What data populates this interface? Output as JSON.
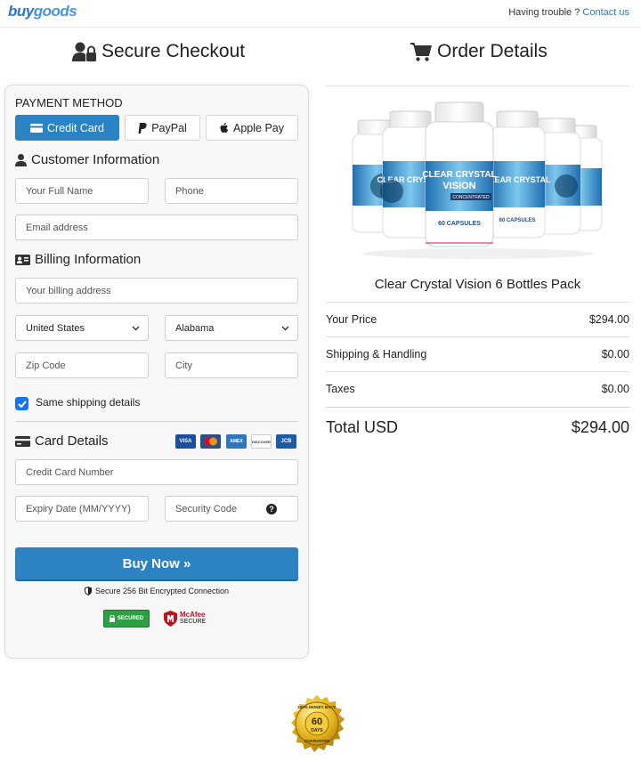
{
  "topbar": {
    "logo_part1": "buy",
    "logo_part2": "goods",
    "help_text": "Having trouble ?",
    "help_link": "Contact us"
  },
  "left_header": {
    "title": "Secure Checkout",
    "icon": "user-lock-icon"
  },
  "right_header": {
    "title": "Order Details",
    "icon": "shopping-cart-icon"
  },
  "payment": {
    "label": "PAYMENT METHOD",
    "methods": [
      {
        "label": "Credit Card",
        "icon": "credit-card-icon",
        "active": true
      },
      {
        "label": "PayPal",
        "icon": "paypal-icon",
        "active": false
      },
      {
        "label": "Apple Pay",
        "icon": "apple-icon",
        "active": false
      }
    ]
  },
  "customer": {
    "title": "Customer Information",
    "name_placeholder": "Your Full Name",
    "phone_placeholder": "Phone",
    "email_placeholder": "Email address"
  },
  "billing": {
    "title": "Billing Information",
    "address_placeholder": "Your billing address",
    "country": "United States",
    "state": "Alabama",
    "zip_placeholder": "Zip Code",
    "city_placeholder": "City",
    "same_shipping": "Same shipping details",
    "same_shipping_checked": true
  },
  "card": {
    "title": "Card Details",
    "brands": [
      "VISA",
      "MC",
      "AMEX",
      "DISCOVER",
      "JCB"
    ],
    "number_placeholder": "Credit Card Number",
    "expiry_placeholder": "Expiry Date (MM/YYYY)",
    "cvv_placeholder": "Security Code"
  },
  "buy_button": "Buy Now »",
  "secure_text": "Secure 256 Bit Encrypted Connection",
  "badges": {
    "secured": "SECURED",
    "mcafee": "McAfee",
    "mcafee_sub": "SECURE"
  },
  "product": {
    "title": "Clear Crystal Vision 6 Bottles Pack",
    "bottle_text1": "CLEAR CRYSTAL",
    "bottle_text2": "VISION",
    "bottle_text3": "CONCENTRATED",
    "bottle_text4": "60 CAPSULES"
  },
  "summary": [
    {
      "label": "Your Price",
      "value": "$294.00"
    },
    {
      "label": "Shipping & Handling",
      "value": "$0.00"
    },
    {
      "label": "Taxes",
      "value": "$0.00"
    }
  ],
  "total": {
    "label": "Total USD",
    "value": "$294.00"
  },
  "seal": {
    "line1": "100% MONEY BACK",
    "days": "60",
    "days_label": "DAYS",
    "line2": "GUARANTEE"
  },
  "colors": {
    "accent": "#2b83c3",
    "link": "#2b76c5",
    "check": "#1a73e8"
  }
}
